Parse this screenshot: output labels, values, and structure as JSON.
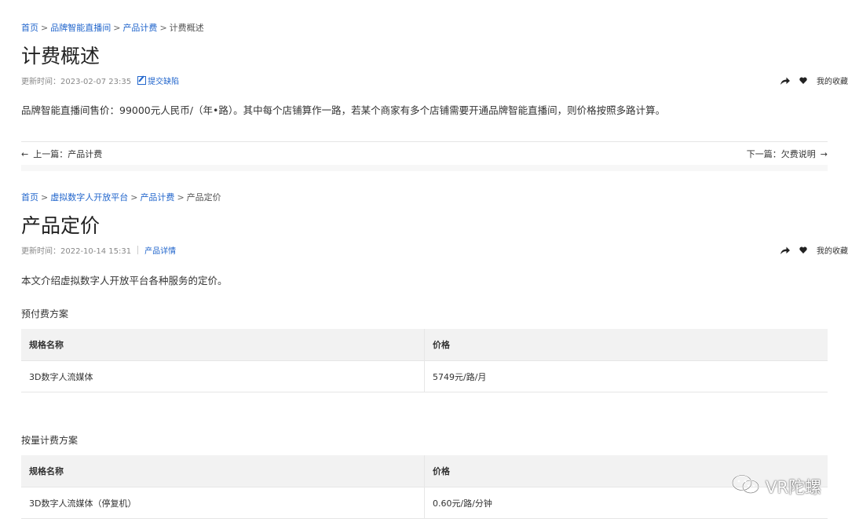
{
  "section1": {
    "breadcrumb": [
      "首页",
      "品牌智能直播间",
      "产品计费",
      "计费概述"
    ],
    "title": "计费概述",
    "updated": "更新时间：2023-02-07 23:35",
    "feedback_link": "提交缺陷",
    "favorite": "我的收藏",
    "paragraph": "品牌智能直播间售价：99000元人民币/（年•路）。其中每个店铺算作一路，若某个商家有多个店铺需要开通品牌智能直播间，则价格按照多路计算。"
  },
  "pager": {
    "prev": "上一篇：产品计费",
    "next": "下一篇：欠费说明"
  },
  "section2": {
    "breadcrumb": [
      "首页",
      "虚拟数字人开放平台",
      "产品计费",
      "产品定价"
    ],
    "title": "产品定价",
    "updated": "更新时间：2022-10-14 15:31",
    "detail_link": "产品详情",
    "favorite": "我的收藏",
    "intro": "本文介绍虚拟数字人开放平台各种服务的定价。",
    "prepaid": {
      "heading": "预付费方案",
      "columns": [
        "规格名称",
        "价格"
      ],
      "rows": [
        [
          "3D数字人流媒体",
          "5749元/路/月"
        ]
      ]
    },
    "payg": {
      "heading": "按量计费方案",
      "columns": [
        "规格名称",
        "价格"
      ],
      "rows": [
        [
          "3D数字人流媒体（停复机）",
          "0.60元/路/分钟"
        ]
      ]
    }
  },
  "watermark": {
    "text": "VR陀螺",
    "icon": "wechat-icon"
  },
  "colors": {
    "link": "#2266cc",
    "table_header": "#f2f2f2"
  }
}
